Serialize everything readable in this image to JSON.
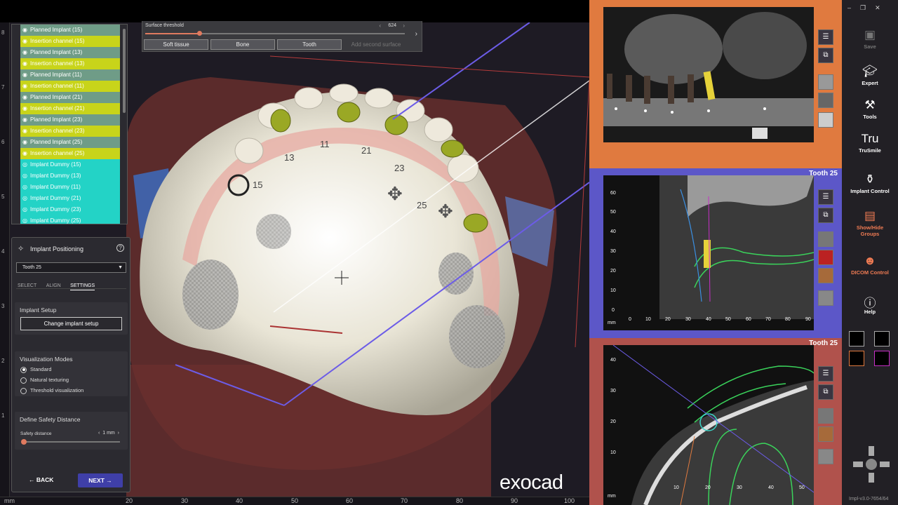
{
  "rulers": {
    "left_ticks": [
      "8",
      "7",
      "6",
      "5",
      "4",
      "3",
      "2",
      "1"
    ],
    "bottom_ticks": [
      "20",
      "30",
      "40",
      "50",
      "60",
      "70",
      "80",
      "90",
      "100"
    ],
    "bottom_unit": "mm"
  },
  "groups": [
    {
      "label": "Planned Implant (15)",
      "kind": "planned"
    },
    {
      "label": "Insertion channel (15)",
      "kind": "channel"
    },
    {
      "label": "Planned Implant (13)",
      "kind": "planned"
    },
    {
      "label": "Insertion channel (13)",
      "kind": "channel"
    },
    {
      "label": "Planned Implant (11)",
      "kind": "planned"
    },
    {
      "label": "Insertion channel (11)",
      "kind": "channel"
    },
    {
      "label": "Planned Implant (21)",
      "kind": "planned"
    },
    {
      "label": "Insertion channel (21)",
      "kind": "channel"
    },
    {
      "label": "Planned Implant (23)",
      "kind": "planned"
    },
    {
      "label": "Insertion channel (23)",
      "kind": "channel"
    },
    {
      "label": "Planned Implant (25)",
      "kind": "planned"
    },
    {
      "label": "Insertion channel (25)",
      "kind": "channel"
    },
    {
      "label": "Implant Dummy (15)",
      "kind": "dummy"
    },
    {
      "label": "Implant Dummy (13)",
      "kind": "dummy"
    },
    {
      "label": "Implant Dummy (11)",
      "kind": "dummy"
    },
    {
      "label": "Implant Dummy (21)",
      "kind": "dummy"
    },
    {
      "label": "Implant Dummy (23)",
      "kind": "dummy"
    },
    {
      "label": "Implant Dummy (25)",
      "kind": "dummy"
    }
  ],
  "threshold": {
    "label": "Surface threshold",
    "value": "624",
    "slider_fraction": 0.2,
    "buttons": [
      "Soft tissue",
      "Bone",
      "Tooth"
    ],
    "add_label": "Add second surface"
  },
  "tooth_labels": [
    "11",
    "21",
    "13",
    "23",
    "15",
    "25"
  ],
  "implant_panel": {
    "title": "Implant Positioning",
    "selected": "Tooth 25",
    "tabs": [
      "SELECT",
      "ALIGN",
      "SETTINGS"
    ],
    "active_tab": "SETTINGS",
    "setup_title": "Implant Setup",
    "setup_button": "Change implant setup",
    "vis_title": "Visualization Modes",
    "vis_options": [
      "Standard",
      "Natural texturing",
      "Threshold visualization"
    ],
    "vis_selected": "Standard",
    "safety_title": "Define Safety Distance",
    "safety_label": "Safety distance",
    "safety_value": "1 mm",
    "back": "BACK",
    "next": "NEXT"
  },
  "brand": "exocad",
  "views": {
    "mid_label": "Tooth 25",
    "bot_label": "Tooth 25",
    "mid_y_ticks": [
      "60",
      "50",
      "40",
      "30",
      "20",
      "10",
      "0"
    ],
    "mid_x_ticks": [
      "0",
      "10",
      "20",
      "30",
      "40",
      "50",
      "60",
      "70",
      "80",
      "90"
    ],
    "bot_y_ticks": [
      "40",
      "30",
      "20",
      "10"
    ],
    "bot_x_ticks": [
      "10",
      "20",
      "30",
      "40",
      "50"
    ],
    "unit": "mm"
  },
  "toolbar": {
    "save": "Save",
    "expert": "Expert",
    "tools": "Tools",
    "trusmile": "TruSmile",
    "trusmile_icon": "Tru",
    "implant_control": "Implant Control",
    "show_hide_1": "Show/Hide",
    "show_hide_2": "Groups",
    "dicom_control": "DICOM Control",
    "help": "Help",
    "version": "Impl-v3.0-7654/64"
  },
  "colors": {
    "planned": "#6f9c87",
    "channel": "#c8d41a",
    "dummy": "#23d3c6",
    "accent": "#e07a5f",
    "pane_top": "#e07a3f",
    "pane_mid": "#5c57c8",
    "pane_bot": "#b0524c"
  }
}
